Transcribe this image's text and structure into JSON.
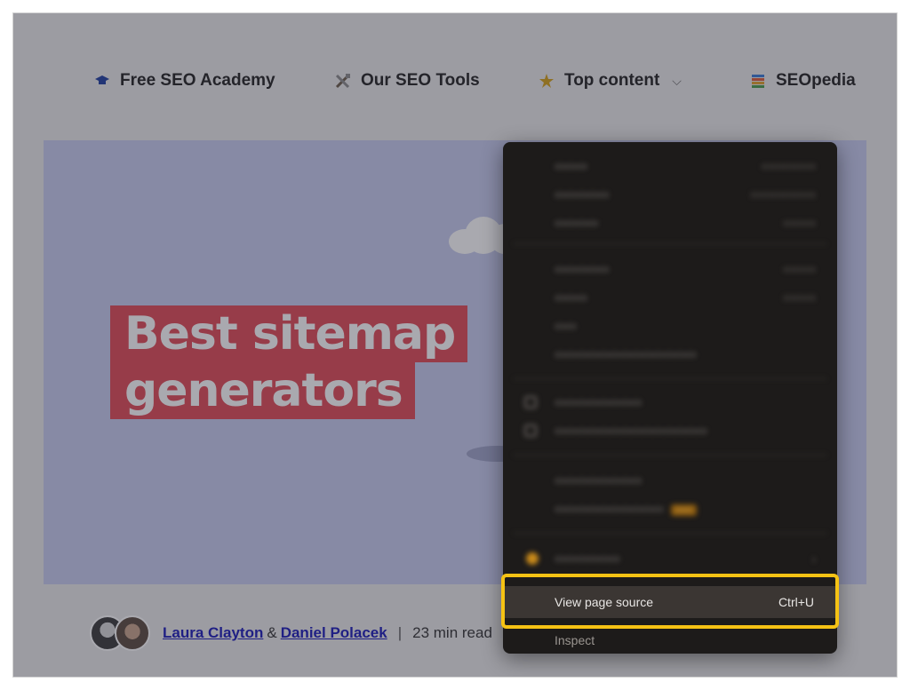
{
  "nav": {
    "items": [
      {
        "label": "Free SEO Academy",
        "icon": "graduation-cap-icon"
      },
      {
        "label": "Our SEO Tools",
        "icon": "tools-icon"
      },
      {
        "label": "Top content",
        "icon": "star-icon",
        "chevron": "⌵"
      },
      {
        "label": "SEOpedia",
        "icon": "books-icon"
      }
    ]
  },
  "hero": {
    "title_line1": "Best sitemap",
    "title_line2": "generators",
    "colors": {
      "background": "#c7cbef",
      "title_bg": "#e14a55"
    }
  },
  "byline": {
    "author1": "Laura Clayton",
    "amp": "&",
    "author2": "Daniel Polacek",
    "separator": "|",
    "read_time": "23 min read"
  },
  "context_menu": {
    "view_source": {
      "label": "View page source",
      "shortcut": "Ctrl+U"
    },
    "inspect": {
      "label": "Inspect"
    },
    "highlight_color": "#f5c214"
  }
}
